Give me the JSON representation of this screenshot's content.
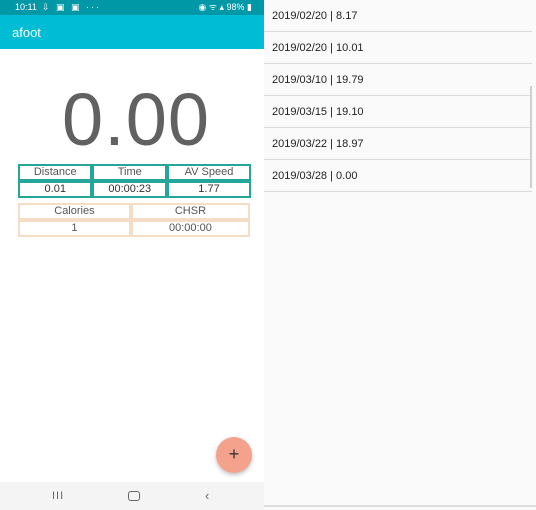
{
  "status_bar": {
    "time": "10:11",
    "notification_icons": "⇩ ▣ ▣ ···",
    "right_text": "◉ ᯤ ▴ 98% ▮"
  },
  "app": {
    "title": "afoot"
  },
  "main": {
    "speed": "0.00"
  },
  "stats_table_1": {
    "headers": [
      "Distance",
      "Time",
      "AV Speed"
    ],
    "values": [
      "0.01",
      "00:00:23",
      "1.77"
    ]
  },
  "stats_table_2": {
    "headers": [
      "Calories",
      "CHSR"
    ],
    "values": [
      "1",
      "00:00:00"
    ]
  },
  "fab": {
    "label": "+"
  },
  "nav_bar": {
    "recent": "III",
    "back": "‹"
  },
  "history": {
    "items": [
      "2019/02/20 | 8.17",
      "2019/02/20 | 10.01",
      "2019/03/10 | 19.79",
      "2019/03/15 | 19.10",
      "2019/03/22 | 18.97",
      "2019/03/28 | 0.00"
    ]
  },
  "colors": {
    "status_bar": "#0097a7",
    "app_bar": "#00bcd4",
    "table1_border": "#26a69a",
    "table2_border": "#f5dcc4",
    "fab": "#f4a28c"
  }
}
